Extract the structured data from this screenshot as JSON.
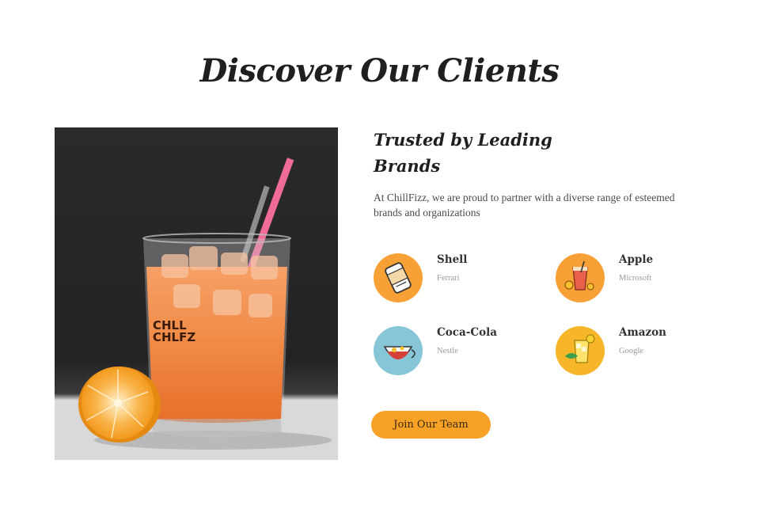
{
  "section": {
    "title": "Discover Our Clients"
  },
  "hero_image": {
    "cup_text_line1": "CHLL",
    "cup_text_line2": "CHLFZ"
  },
  "content": {
    "subtitle_line1": "Trusted by Leading",
    "subtitle_line2": "Brands",
    "intro": "At ChillFizz, we are proud to partner with a diverse range of esteemed brands and organizations"
  },
  "clients": [
    {
      "name": "Shell",
      "sub": "Ferrari",
      "icon": "soda-can-icon",
      "bg": "#f7a035"
    },
    {
      "name": "Apple",
      "sub": "Microsoft",
      "icon": "cocktail-glass-icon",
      "bg": "#f7a035"
    },
    {
      "name": "Coca-Cola",
      "sub": "Nestle",
      "icon": "punch-bowl-icon",
      "bg": "#86c6d6"
    },
    {
      "name": "Amazon",
      "sub": "Google",
      "icon": "lemonade-glass-icon",
      "bg": "#f7b52a"
    }
  ],
  "cta": {
    "join_label": "Join Our Team"
  },
  "colors": {
    "accent": "#f7a127",
    "heading": "#1f1f1f",
    "muted": "#9a9a9a"
  }
}
